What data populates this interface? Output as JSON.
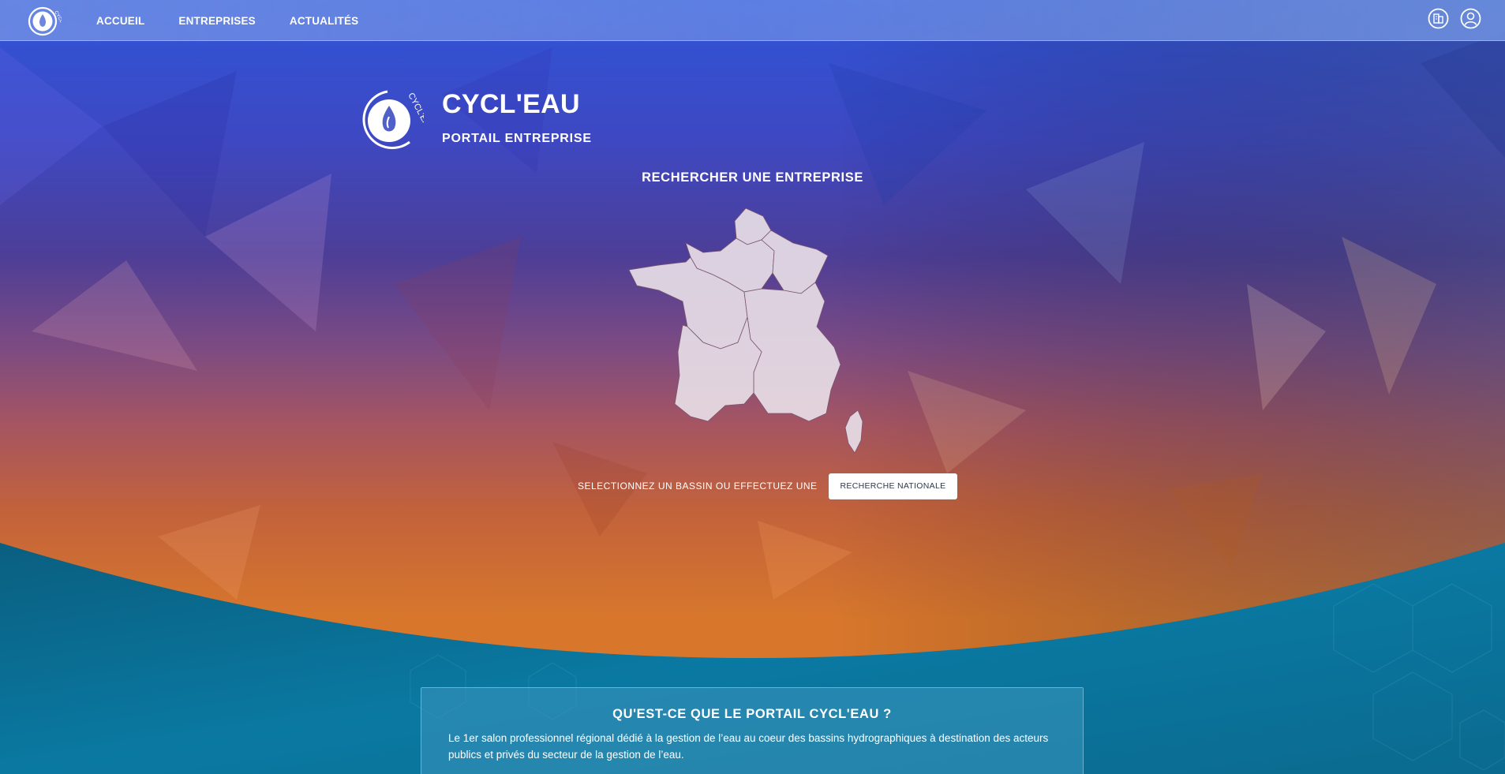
{
  "nav": {
    "logo_text": "CYCL'EAU",
    "links": [
      {
        "label": "ACCUEIL"
      },
      {
        "label": "ENTREPRISES"
      },
      {
        "label": "ACTUALITÉS"
      }
    ],
    "icons": [
      "building-icon",
      "user-icon"
    ]
  },
  "brand": {
    "title": "CYCL'EAU",
    "subtitle": "PORTAIL ENTREPRISE",
    "logo_ring_text": "CYCL'EAU"
  },
  "search": {
    "heading": "RECHERCHER UNE ENTREPRISE",
    "select_text": "SELECTIONNEZ UN BASSIN OU EFFECTUEZ UNE",
    "national_button": "RECHERCHE NATIONALE"
  },
  "info": {
    "title": "QU'EST-CE QUE LE PORTAIL CYCL'EAU ?",
    "text": "Le 1er salon professionnel régional dédié à la gestion de l’eau au coeur des bassins hydrographiques à destination des acteurs publics et privés du secteur de la gestion de l’eau."
  },
  "colors": {
    "top_blue": "#3f4fcf",
    "mid_purple": "#5a3f8f",
    "mid_rose": "#a4515a",
    "orange": "#d9722e",
    "teal": "#0c7296",
    "white": "#ffffff"
  }
}
